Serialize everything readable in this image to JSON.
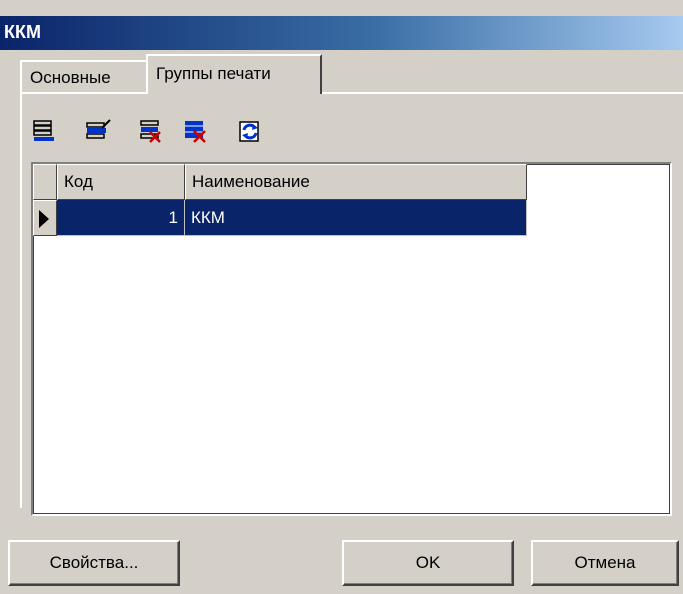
{
  "window": {
    "title": "ККМ"
  },
  "tabs": [
    {
      "label": "Основные",
      "active": false
    },
    {
      "label": "Группы печати",
      "active": true
    }
  ],
  "toolbar": {
    "buttons": [
      {
        "icon": "add-record-icon"
      },
      {
        "icon": "edit-record-icon"
      },
      {
        "icon": "delete-record-icon"
      },
      {
        "icon": "delete-all-icon"
      },
      {
        "icon": "refresh-icon"
      }
    ]
  },
  "grid": {
    "columns": [
      "Код",
      "Наименование"
    ],
    "rows": [
      {
        "code": "1",
        "name": "ККМ",
        "selected": true
      }
    ]
  },
  "buttons": {
    "properties": "Свойства...",
    "ok": "OK",
    "cancel": "Отмена"
  },
  "colors": {
    "selection": "#0a246a",
    "face": "#d4d0c8",
    "title_start": "#0a246a",
    "title_end": "#a6caf0"
  }
}
